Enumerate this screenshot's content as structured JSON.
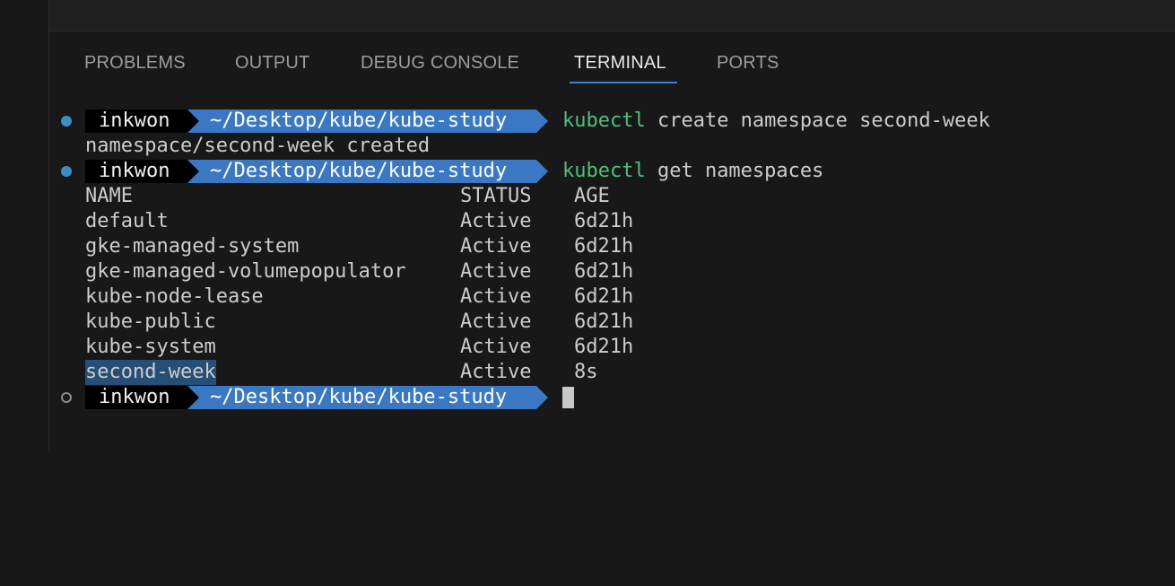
{
  "tabs": [
    {
      "label": "PROBLEMS"
    },
    {
      "label": "OUTPUT"
    },
    {
      "label": "DEBUG CONSOLE"
    },
    {
      "label": "TERMINAL"
    },
    {
      "label": "PORTS"
    }
  ],
  "active_tab": "TERMINAL",
  "prompt": {
    "user": "inkwon",
    "path": "~/Desktop/kube/kube-study"
  },
  "commands": [
    {
      "program": "kubectl",
      "args": " create namespace second-week"
    },
    {
      "program": "kubectl",
      "args": " get namespaces"
    }
  ],
  "create_output": "namespace/second-week created",
  "table": {
    "headers": [
      "NAME",
      "STATUS",
      "AGE"
    ],
    "rows": [
      [
        "default",
        "Active",
        "6d21h"
      ],
      [
        "gke-managed-system",
        "Active",
        "6d21h"
      ],
      [
        "gke-managed-volumepopulator",
        "Active",
        "6d21h"
      ],
      [
        "kube-node-lease",
        "Active",
        "6d21h"
      ],
      [
        "kube-public",
        "Active",
        "6d21h"
      ],
      [
        "kube-system",
        "Active",
        "6d21h"
      ],
      [
        "second-week",
        "Active",
        "8s"
      ]
    ]
  },
  "colors": {
    "background": "#181818",
    "prompt_user_bg": "#000000",
    "prompt_path_bg": "#3a78c4",
    "command_keyword": "#4fbf7a",
    "selection_highlight": "#264f78",
    "tab_underline": "#3b82d6",
    "status_dot_success": "#3a8fc0"
  }
}
